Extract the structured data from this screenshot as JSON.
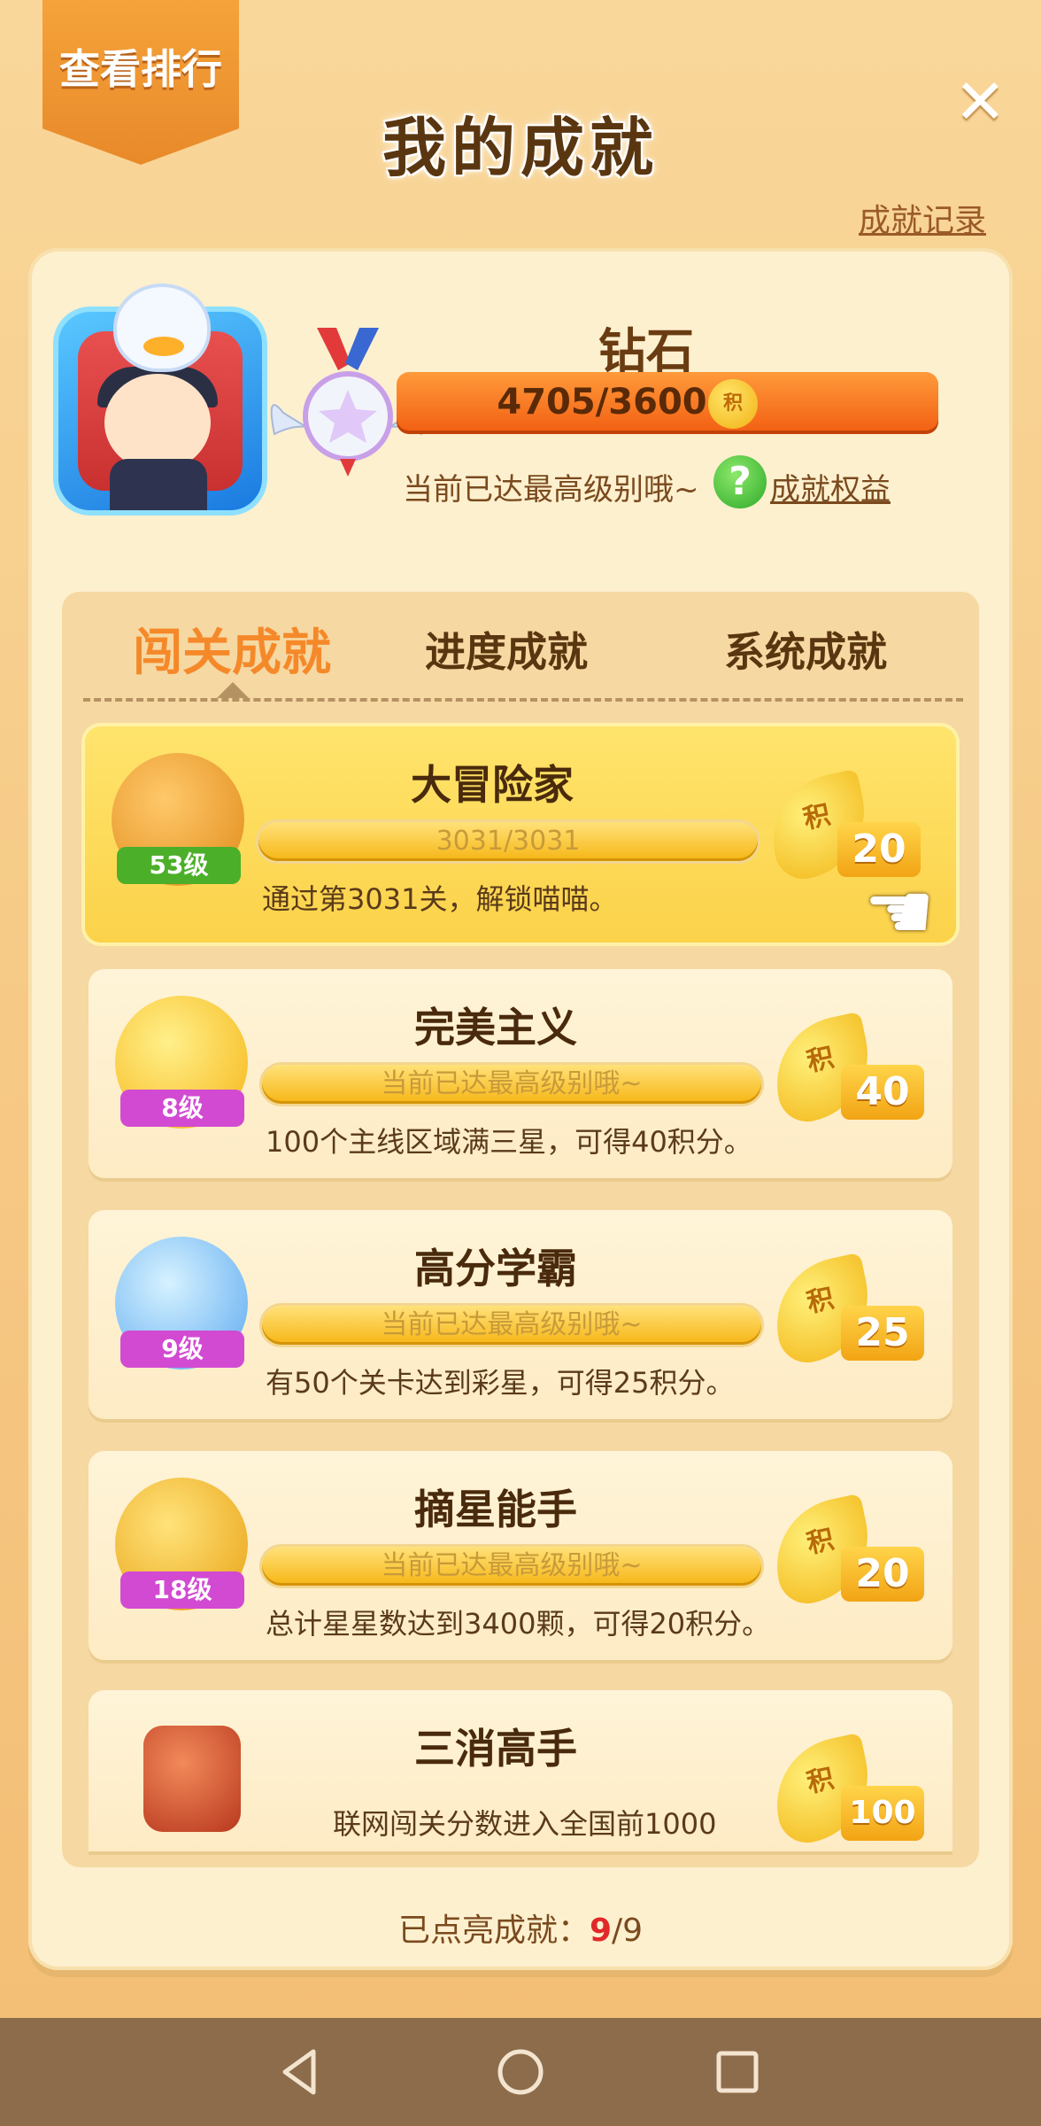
{
  "header": {
    "rank_button": "查看排行",
    "title": "我的成就",
    "close_symbol": "✕",
    "records_link": "成就记录"
  },
  "profile": {
    "level_name": "钻石",
    "progress_text": "4705/3600",
    "coin_label": "积",
    "max_note": "当前已达最高级别哦~",
    "help_symbol": "?",
    "rights_link": "成就权益"
  },
  "tabs": [
    "闯关成就",
    "进度成就",
    "系统成就"
  ],
  "achievements": [
    {
      "title": "大冒险家",
      "level": "53级",
      "bar_text": "3031/3031",
      "progress": 1.0,
      "desc": "通过第3031关，解锁喵喵。",
      "reward_label": "积",
      "reward": "20",
      "badge_color": "#f0a020",
      "level_color": "#4caf2a"
    },
    {
      "title": "完美主义",
      "level": "8级",
      "bar_text": "当前已达最高级别哦~",
      "desc": "100个主线区域满三星，可得40积分。",
      "reward_label": "积",
      "reward": "40",
      "badge_color": "#ffd23a",
      "level_color": "#d24ad2"
    },
    {
      "title": "高分学霸",
      "level": "9级",
      "bar_text": "当前已达最高级别哦~",
      "desc": "有50个关卡达到彩星，可得25积分。",
      "reward_label": "积",
      "reward": "25",
      "badge_color": "#7ad0ff",
      "level_color": "#d24ad2"
    },
    {
      "title": "摘星能手",
      "level": "18级",
      "bar_text": "当前已达最高级别哦~",
      "desc": "总计星星数达到3400颗，可得20积分。",
      "reward_label": "积",
      "reward": "20",
      "badge_color": "#f7c02a",
      "level_color": "#d24ad2"
    },
    {
      "title": "三消高手",
      "desc": "联网闯关分数进入全国前1000",
      "reward_label": "积",
      "reward": "100",
      "badge_color": "#c8452a"
    }
  ],
  "footer": {
    "label": "已点亮成就：",
    "lit": "9",
    "total": "/9"
  },
  "navbar": {
    "back_symbol": "◁",
    "home_symbol": "○",
    "recents_symbol": "□"
  }
}
